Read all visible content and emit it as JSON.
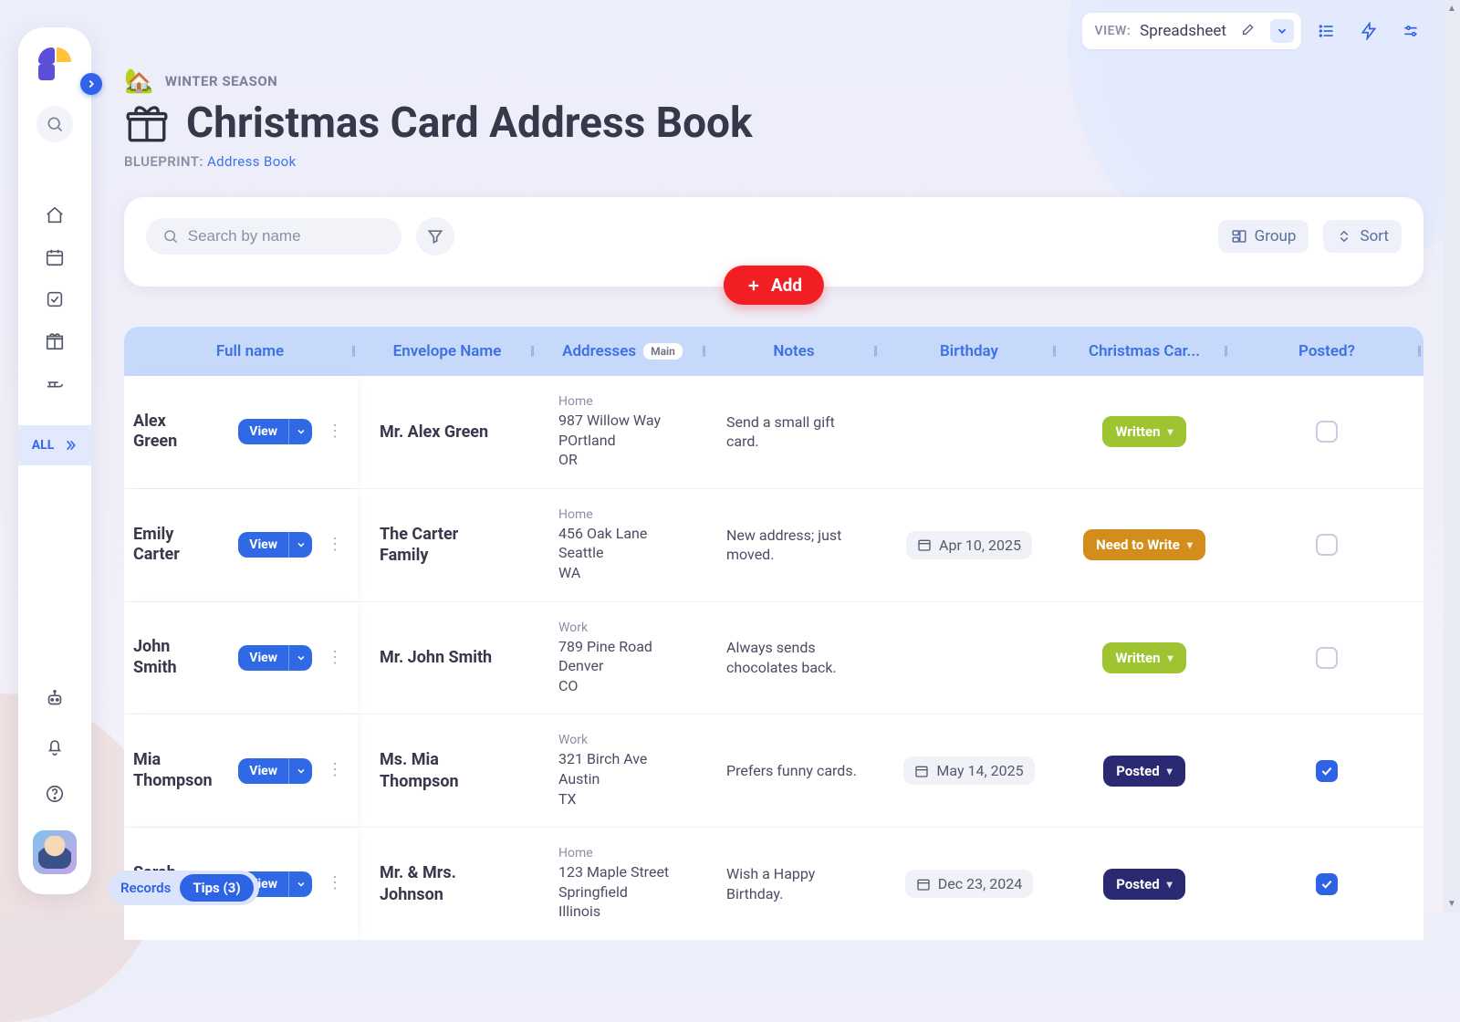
{
  "sidebar": {
    "all_label": "ALL"
  },
  "topbar": {
    "view_label": "VIEW:",
    "view_value": "Spreadsheet"
  },
  "header": {
    "season": "WINTER SEASON",
    "title": "Christmas Card Address Book",
    "blueprint_label": "BLUEPRINT:",
    "blueprint_value": "Address Book"
  },
  "toolbar": {
    "search_placeholder": "Search by name",
    "group_label": "Group",
    "sort_label": "Sort",
    "add_label": "Add"
  },
  "footer": {
    "records": "Records",
    "tips": "Tips (3)"
  },
  "table": {
    "columns": {
      "full_name": "Full name",
      "envelope": "Envelope Name",
      "addresses": "Addresses",
      "addresses_badge": "Main",
      "notes": "Notes",
      "birthday": "Birthday",
      "status": "Christmas Car...",
      "posted": "Posted?"
    },
    "view_button": "View",
    "status_labels": {
      "written": "Written",
      "need": "Need to Write",
      "posted": "Posted"
    },
    "rows": [
      {
        "full_name": "Alex Green",
        "envelope": "Mr. Alex Green",
        "addr_type": "Home",
        "addr_l1": "987 Willow Way",
        "addr_l2": "POrtland",
        "addr_l3": "OR",
        "notes": "Send a small gift card.",
        "birthday": "",
        "status": "written",
        "posted": false
      },
      {
        "full_name": "Emily Carter",
        "envelope": "The Carter Family",
        "addr_type": "Home",
        "addr_l1": "456 Oak Lane",
        "addr_l2": "Seattle",
        "addr_l3": "WA",
        "notes": "New address; just moved.",
        "birthday": "Apr 10, 2025",
        "status": "need",
        "posted": false
      },
      {
        "full_name": "John Smith",
        "envelope": "Mr. John Smith",
        "addr_type": "Work",
        "addr_l1": "789 Pine Road",
        "addr_l2": "Denver",
        "addr_l3": "CO",
        "notes": "Always sends chocolates back.",
        "birthday": "",
        "status": "written",
        "posted": false
      },
      {
        "full_name": "Mia Thompson",
        "envelope": "Ms. Mia Thompson",
        "addr_type": "Work",
        "addr_l1": "321 Birch Ave",
        "addr_l2": "Austin",
        "addr_l3": "TX",
        "notes": "Prefers funny cards.",
        "birthday": "May 14, 2025",
        "status": "posted",
        "posted": true
      },
      {
        "full_name": "Sarah Johnson",
        "envelope": "Mr. & Mrs. Johnson",
        "addr_type": "Home",
        "addr_l1": "123 Maple Street",
        "addr_l2": "Springfield",
        "addr_l3": "Illinois",
        "notes": "Wish a Happy Birthday.",
        "birthday": "Dec 23, 2024",
        "status": "posted",
        "posted": true
      }
    ]
  }
}
